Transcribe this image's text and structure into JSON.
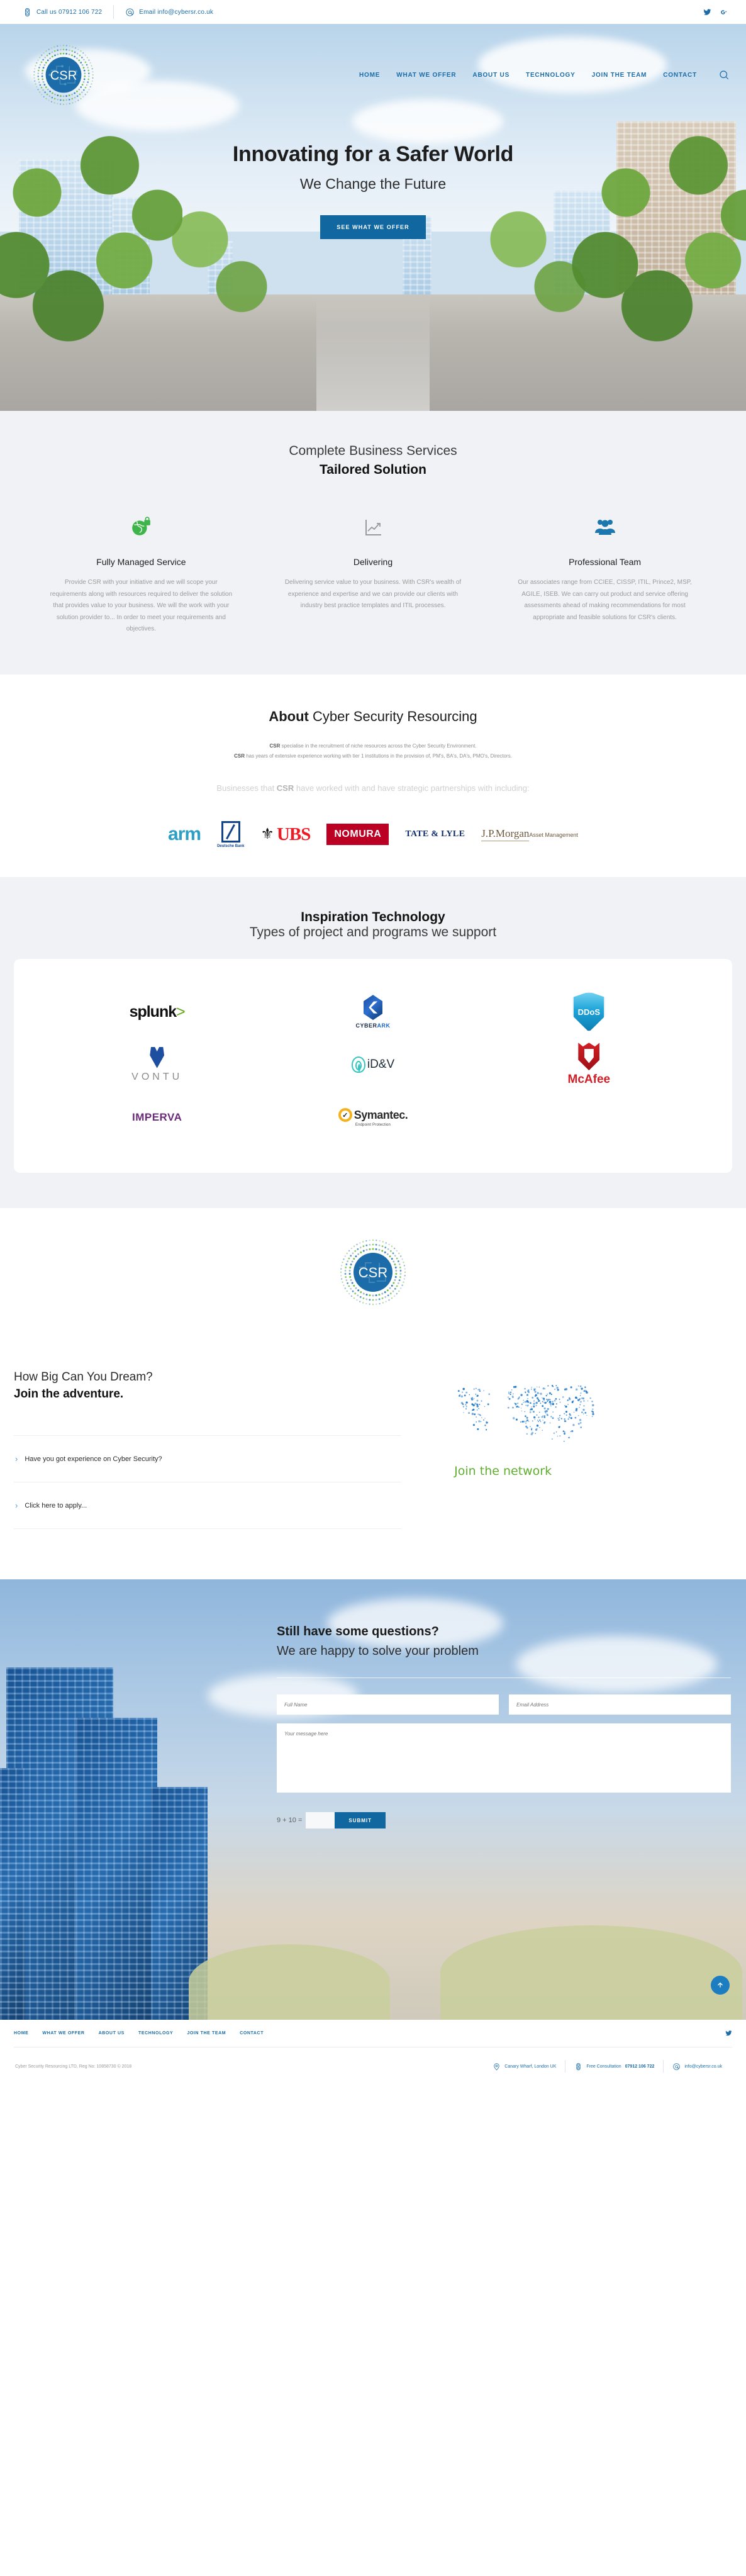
{
  "topbar": {
    "phone": "Call us 07912 106 722",
    "email": "Email info@cybersr.co.uk",
    "social": [
      "twitter-icon",
      "google-plus-icon"
    ]
  },
  "brand": {
    "logo_text": "CSR",
    "logo_ring_text": "CYBER SECURITY RESOURCING"
  },
  "nav": {
    "items": [
      {
        "label": "HOME"
      },
      {
        "label": "WHAT WE OFFER"
      },
      {
        "label": "ABOUT US"
      },
      {
        "label": "TECHNOLOGY"
      },
      {
        "label": "JOIN THE TEAM"
      },
      {
        "label": "CONTACT"
      }
    ],
    "search_icon": "search-icon"
  },
  "hero": {
    "title": "Innovating for a Safer World",
    "subtitle": "We Change the Future",
    "cta": "SEE WHAT WE OFFER"
  },
  "services": {
    "sub": "Complete Business Services",
    "title": "Tailored Solution",
    "cards": [
      {
        "icon": "globe-lock-icon",
        "title": "Fully Managed Service",
        "text": "Provide CSR with your initiative and we will scope your requirements along with resources required to deliver the solution that provides value to your business. We will the work with your solution provider to... In order to meet your requirements and objectives."
      },
      {
        "icon": "growth-chart-icon",
        "title": "Delivering",
        "text": "Delivering service value to your business. With CSR's wealth of experience and expertise and we can provide our clients with industry best practice templates and ITIL processes."
      },
      {
        "icon": "team-people-icon",
        "title": "Professional Team",
        "text": "Our associates range from CCIEE, CISSP, ITIL, Prince2, MSP, AGILE, ISEB. We can carry out product and service offering assessments ahead of making recommendations for most appropriate and feasible solutions for CSR's clients."
      }
    ]
  },
  "about": {
    "heading_bold": "About",
    "heading_light": "Cyber Security Resourcing",
    "line1_bold": "CSR",
    "line1": " specialise in the recruitment of niche resources across the Cyber Security Environment.",
    "line2_bold": "CSR",
    "line2": " has years of extensive experience working with tier 1 institutions in the provision of, PM's, BA's, DA's, PMO's, Directors.",
    "partners_intro_a": "Businesses that ",
    "partners_intro_b": "CSR",
    "partners_intro_c": " have worked with and have strategic partnerships with including:",
    "partners": [
      {
        "name": "arm"
      },
      {
        "name": "Deutsche Bank"
      },
      {
        "name": "UBS"
      },
      {
        "name": "NOMURA"
      },
      {
        "name": "TATE & LYLE"
      },
      {
        "name": "J.P.Morgan Asset Management"
      }
    ]
  },
  "technology": {
    "title": "Inspiration Technology",
    "sub": "Types of project and programs we support",
    "logos": [
      {
        "name": "splunk"
      },
      {
        "name": "CYBERARK"
      },
      {
        "name": "DDoS"
      },
      {
        "name": "VONTU"
      },
      {
        "name": "iD&V"
      },
      {
        "name": "McAfee"
      },
      {
        "name": "IMPERVA"
      },
      {
        "name": "Symantec Endpoint Protection"
      }
    ],
    "splunk_main": "splunk",
    "splunk_mark": ">",
    "cyberark_a": "CYBER",
    "cyberark_b": "ARK",
    "ddos": "DDoS",
    "vontu": "VONTU",
    "idv": "iD&V",
    "mcafee": "McAfee",
    "imperva": "IMPERVA",
    "symantec": "Symantec.",
    "symantec_sub": "Endpoint Protection",
    "symantec_check": "✓"
  },
  "join": {
    "sub": "How Big Can You Dream?",
    "title": "Join the adventure.",
    "items": [
      {
        "label": "Have you got experience on Cyber Security?"
      },
      {
        "label": "Click here to apply..."
      }
    ],
    "network_caption": "Join the network"
  },
  "contact": {
    "title": "Still have some questions?",
    "sub": "We are happy to solve your problem",
    "name_placeholder": "Full Name",
    "email_placeholder": "Email Address",
    "message_placeholder": "Your message here",
    "captcha_label": "9 + 10 =",
    "captcha_value": "",
    "submit": "SUBMIT",
    "to_top_icon": "arrow-up-icon"
  },
  "footer": {
    "nav": [
      {
        "label": "HOME"
      },
      {
        "label": "WHAT WE OFFER"
      },
      {
        "label": "ABOUT US"
      },
      {
        "label": "TECHNOLOGY"
      },
      {
        "label": "JOIN THE TEAM"
      },
      {
        "label": "CONTACT"
      }
    ],
    "social": "twitter-icon",
    "copyright": "Cyber Security Resourcing LTD, Reg No: 10858730 © 2018",
    "location": "Canary Wharf, London UK",
    "consultation_label": "Free Consultation ",
    "consultation_phone": "07912 106 722",
    "email": "info@cybersr.co.uk"
  },
  "colors": {
    "brand_blue": "#1168a0",
    "link_blue": "#1b6ca8",
    "green": "#5fae2e",
    "light_bg": "#f0f2f6"
  }
}
